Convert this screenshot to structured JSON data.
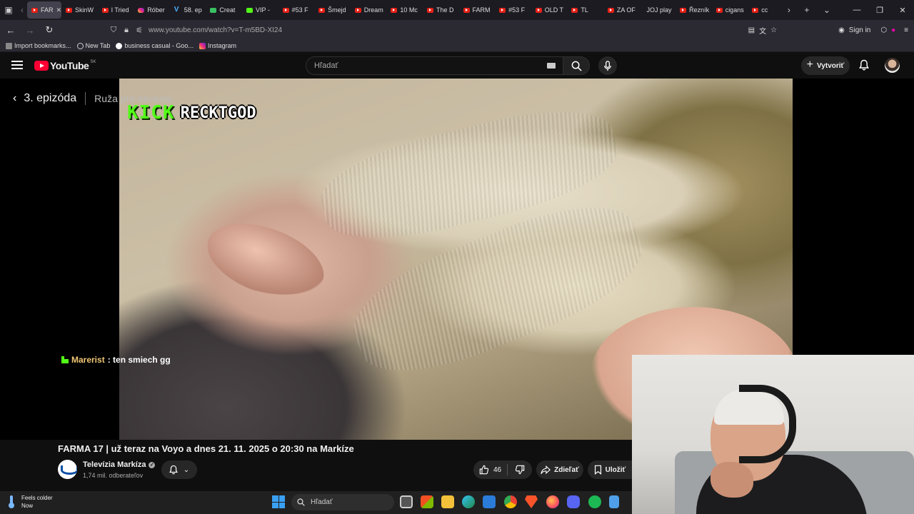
{
  "browser": {
    "tabs": [
      {
        "label": "FAR",
        "favicon": "youtube",
        "active": true
      },
      {
        "label": "SkinW",
        "favicon": "youtube"
      },
      {
        "label": "I Tried",
        "favicon": "youtube"
      },
      {
        "label": "Róber",
        "favicon": "instagram"
      },
      {
        "label": "58. ep",
        "favicon": "v"
      },
      {
        "label": "Creat",
        "favicon": "green"
      },
      {
        "label": "VIP -",
        "favicon": "kick"
      },
      {
        "label": "#53 F",
        "favicon": "youtube"
      },
      {
        "label": "Šmejd",
        "favicon": "youtube"
      },
      {
        "label": "Dream",
        "favicon": "youtube"
      },
      {
        "label": "10 Mc",
        "favicon": "youtube"
      },
      {
        "label": "The D",
        "favicon": "youtube"
      },
      {
        "label": "FARM",
        "favicon": "youtube"
      },
      {
        "label": "#53 F",
        "favicon": "youtube"
      },
      {
        "label": "OLD T",
        "favicon": "youtube"
      },
      {
        "label": "TL",
        "favicon": "youtube"
      },
      {
        "label": "ZA OF",
        "favicon": "youtube"
      },
      {
        "label": "JOJ play",
        "favicon": "none"
      },
      {
        "label": "Řezník",
        "favicon": "youtube"
      },
      {
        "label": "cigans",
        "favicon": "youtube"
      },
      {
        "label": "cc",
        "favicon": "youtube"
      }
    ],
    "url": "www.youtube.com/watch?v=T-m5BD-XI24",
    "sign_in": "Sign in",
    "bookmarks": [
      {
        "label": "Import bookmarks...",
        "icon": "import-icon"
      },
      {
        "label": "New Tab",
        "icon": "globe-icon"
      },
      {
        "label": "business casual - Goo...",
        "icon": "google-icon"
      },
      {
        "label": "Instagram",
        "icon": "instagram-icon"
      }
    ]
  },
  "youtube": {
    "logo_text": "YouTube",
    "region": "SK",
    "search_placeholder": "Hľadať",
    "create_label": "Vytvoriť"
  },
  "player": {
    "episode": "3. epizóda",
    "episode_subtitle": "Ruža pre nevestu",
    "kick_logo": "KICK",
    "streamer_name": "RECKTGOD",
    "chat": {
      "user": "Marerist",
      "message": ": ten smiech gg"
    }
  },
  "video": {
    "title": "FARMA 17 | už teraz na Voyo a dnes 21. 11. 2025 o 20:30 na Markíze",
    "channel_name": "Televízia Markíza",
    "subscribers": "1,74 mil. odberateľov",
    "likes": "46",
    "share_label": "Zdieľať",
    "save_label": "Uložiť"
  },
  "taskbar": {
    "weather_line1": "Feels colder",
    "weather_line2": "Now",
    "search_label": "Hľadať"
  },
  "colors": {
    "youtube_red": "#ff0033",
    "kick_green": "#53fc18",
    "chat_user": "#f0c674"
  }
}
